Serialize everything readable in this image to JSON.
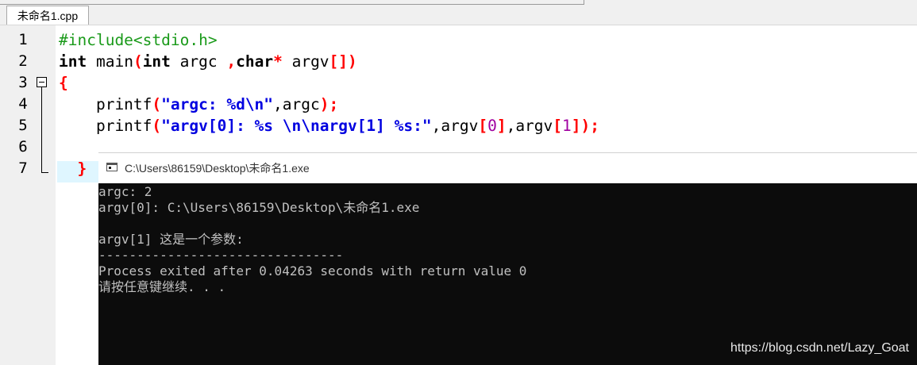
{
  "editor": {
    "tab_label": "未命名1.cpp",
    "line_numbers": [
      "1",
      "2",
      "3",
      "4",
      "5",
      "6",
      "7"
    ],
    "code": {
      "line1": "#include<stdio.h>",
      "line2": {
        "t1": "int",
        "t2": " main",
        "t3": "(",
        "t4": "int",
        "t5": " argc ",
        "t6": ",",
        "t7": "char",
        "t8": "*",
        "t9": " argv",
        "t10": "[]",
        "t11": ")"
      },
      "line3": "{",
      "line4": {
        "t1": "    printf",
        "t2": "(",
        "t3": "\"argc: %d\\n\"",
        "t4": ",argc",
        "t5": ");"
      },
      "line5": {
        "t1": "    printf",
        "t2": "(",
        "t3": "\"argv[0]: %s \\n\\nargv[1] %s:\"",
        "t4": ",argv",
        "t5": "[",
        "t6": "0",
        "t7": "]",
        "t8": ",argv",
        "t9": "[",
        "t10": "1",
        "t11": "]);"
      },
      "line7": "  }"
    }
  },
  "console": {
    "title": "C:\\Users\\86159\\Desktop\\未命名1.exe",
    "output": [
      "argc: 2",
      "argv[0]: C:\\Users\\86159\\Desktop\\未命名1.exe",
      "",
      "argv[1] 这是一个参数:",
      "--------------------------------",
      "Process exited after 0.04263 seconds with return value 0",
      "请按任意键继续. . ."
    ]
  },
  "watermark": "https://blog.csdn.net/Lazy_Goat",
  "colors": {
    "preprocessor": "#1a9a1a",
    "string": "#0000e0",
    "bracket": "#ff0000",
    "number": "#a000a0",
    "console_bg": "#0c0c0c",
    "console_text": "#c0c0c0"
  },
  "icons": {
    "console": "console-window-icon",
    "fold": "fold-minus-icon"
  }
}
